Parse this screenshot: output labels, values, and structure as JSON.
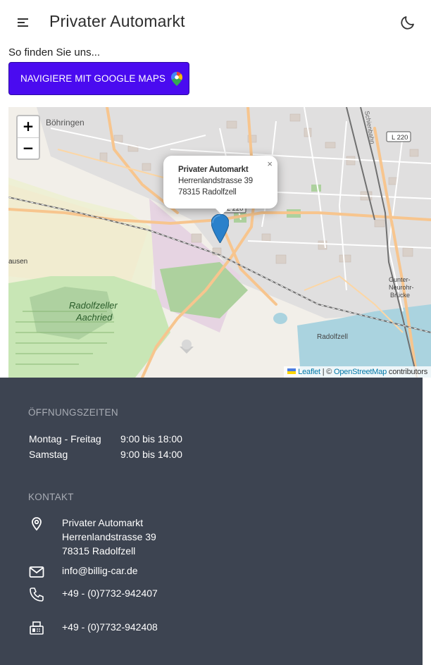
{
  "header": {
    "title": "Privater Automarkt",
    "menu_icon": "menu-icon",
    "theme_icon": "moon-icon"
  },
  "location": {
    "heading": "So finden Sie uns...",
    "nav_button_label": "NAVIGIERE MIT GOOGLE MAPS",
    "nav_button_icon": "google-maps-pin-icon"
  },
  "map": {
    "zoom_in": "+",
    "zoom_out": "−",
    "popup": {
      "close": "×",
      "name": "Privater Automarkt",
      "street": "Herrenlandstrasse 39",
      "city": "78315 Radolfzell"
    },
    "attribution": {
      "leaflet": "Leaflet",
      "sep": "| ©",
      "osm": "OpenStreetMap",
      "contributors": "contributors"
    },
    "labels": {
      "boehringen": "Böhringen",
      "l220_top": "L 220",
      "l220_mid": "L 220",
      "hausen": "ausen",
      "aachried_1": "Radolfzeller",
      "aachried_2": "Aachried",
      "radolfzell": "Radolfzell",
      "brucke_1": "Gunter-",
      "brucke_2": "Neurohr-",
      "brucke_3": "Brücke",
      "bahn": "Schienbahn"
    }
  },
  "footer": {
    "hours_title": "ÖFFNUNGSZEITEN",
    "hours": [
      {
        "day": "Montag - Freitag",
        "time": "9:00 bis 18:00"
      },
      {
        "day": "Samstag",
        "time": "9:00 bis 14:00"
      }
    ],
    "contact_title": "KONTAKT",
    "address": {
      "name": "Privater Automarkt",
      "street": "Herrenlandstrasse 39",
      "city": "78315 Radolfzell"
    },
    "email": "info@billig-car.de",
    "phone": "+49 - (0)7732-942407",
    "fax": "+49 - (0)7732-942408"
  },
  "colors": {
    "primary_button": "#4a0bf0",
    "footer_bg": "#3d4451",
    "marker": "#2a81cb",
    "link": "#0078a8"
  }
}
